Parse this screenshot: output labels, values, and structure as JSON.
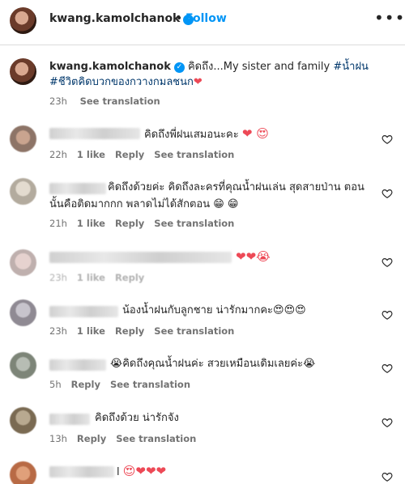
{
  "header": {
    "username": "kwang.kamolchanok",
    "separator": "•",
    "follow_label": "Follow",
    "more_icon": "more-horizontal-icon"
  },
  "caption": {
    "username": "kwang.kamolchanok",
    "text_a": "คิดถึง...My sister and family ",
    "hashtag1": "#น้ำฝน",
    "hashtag2": "#ชีวิตคิดบวกของกวางกมลชนก",
    "heart": "❤",
    "time": "23h",
    "see_translation": "See translation"
  },
  "comments": [
    {
      "text": "คิดถึงพี่ฝนเสมอนะคะ",
      "emoji": "❤ 😍",
      "time": "22h",
      "likes": "1 like",
      "reply": "Reply",
      "see_translation": "See translation"
    },
    {
      "text_line1": "คิดถึงด้วยค่ะ คิดถึงละครที่คุณน้ำฝนเล่น สุดสายป่าน ตอน",
      "text_line2": "นั้นคือติดมากกก พลาดไม่ได้สักตอน",
      "emoji": "😁 😁",
      "time": "21h",
      "likes": "1 like",
      "reply": "Reply",
      "see_translation": "See translation"
    },
    {
      "emoji": "❤❤😭",
      "time": "23h",
      "likes": "1 like",
      "reply": "Reply"
    },
    {
      "text": "น้องน้ำฝนกับลูกชาย น่ารักมากคะ",
      "emoji": "😍😍😍",
      "time": "23h",
      "likes": "1 like",
      "reply": "Reply",
      "see_translation": "See translation"
    },
    {
      "text": "คิดถึงคุณน้ำฝนค่ะ สวยเหมือนเดิมเลยค่ะ",
      "emoji_before": "😭",
      "emoji": "😭",
      "time": "5h",
      "reply": "Reply",
      "see_translation": "See translation"
    },
    {
      "text": "คิดถึงด้วย น่ารักจัง",
      "time": "13h",
      "reply": "Reply",
      "see_translation": "See translation"
    },
    {
      "text": "l",
      "emoji": "😍❤❤❤"
    }
  ],
  "colors": {
    "link_blue": "#0095f6",
    "hashtag": "#00376b",
    "meta_gray": "#737373",
    "heart_red": "#ed4956"
  }
}
